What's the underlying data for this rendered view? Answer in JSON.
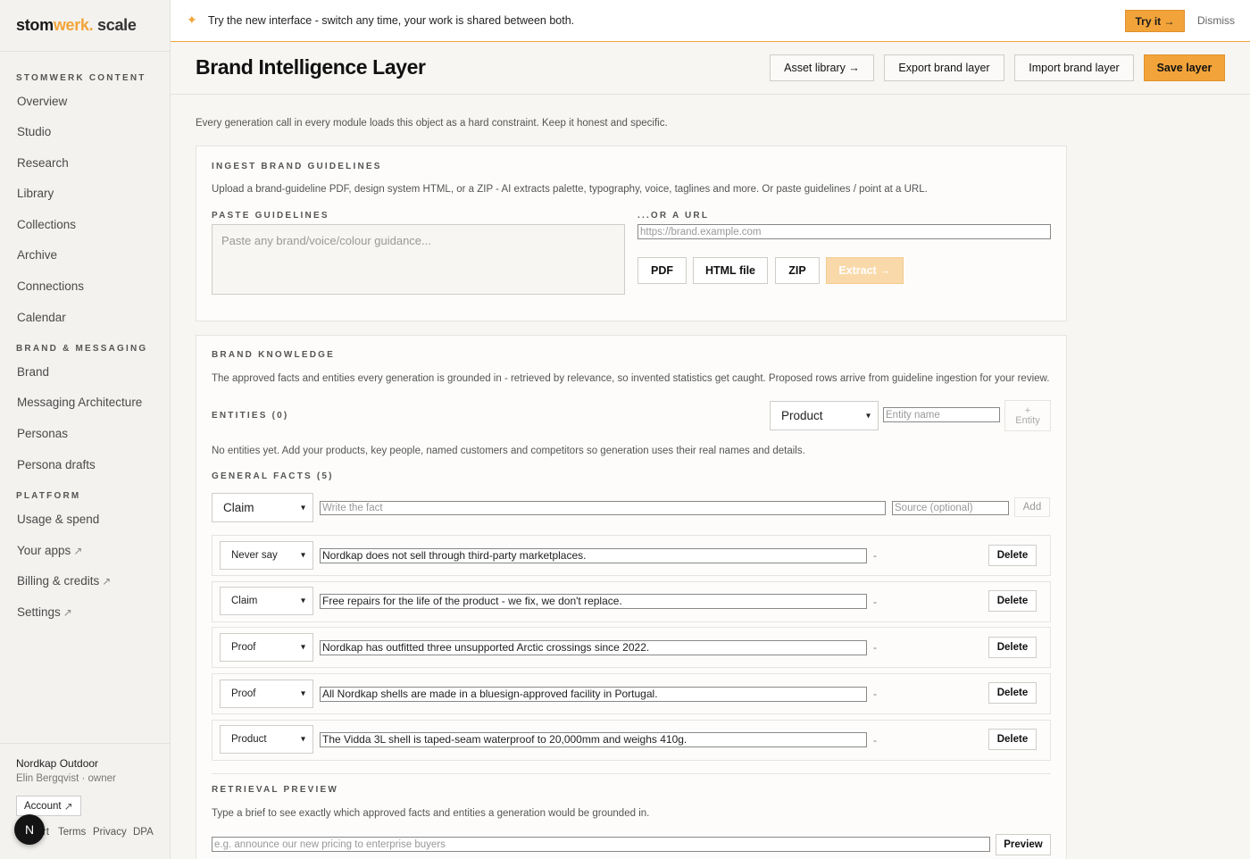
{
  "app": {
    "logo_part1": "stom",
    "logo_part2": "werk.",
    "logo_part3": " scale"
  },
  "sidebar": {
    "sections": [
      {
        "label": "STOMWERK CONTENT"
      },
      {
        "label": "BRAND & MESSAGING"
      },
      {
        "label": "PLATFORM"
      }
    ],
    "items": [
      {
        "label": "Overview"
      },
      {
        "label": "Studio"
      },
      {
        "label": "Research"
      },
      {
        "label": "Library"
      },
      {
        "label": "Collections"
      },
      {
        "label": "Archive"
      },
      {
        "label": "Connections"
      },
      {
        "label": "Calendar"
      },
      {
        "label": "Brand"
      },
      {
        "label": "Messaging Architecture"
      },
      {
        "label": "Personas"
      },
      {
        "label": "Persona drafts"
      },
      {
        "label": "Usage & spend"
      },
      {
        "label": "Your apps"
      },
      {
        "label": "Billing & credits"
      },
      {
        "label": "Settings"
      }
    ],
    "ext_arrow": "↗",
    "org": "Nordkap Outdoor",
    "user": "Elin Bergqvist · owner",
    "account_label": "Account",
    "footer_links": [
      "rt",
      "Terms",
      "Privacy",
      "DPA"
    ],
    "avatar_letter": "N"
  },
  "banner": {
    "text": "Try the new interface - switch any time, your work is shared between both.",
    "try_label": "Try it →",
    "dismiss_label": "Dismiss"
  },
  "header": {
    "title": "Brand Intelligence Layer",
    "asset_library": "Asset library →",
    "export": "Export brand layer",
    "import": "Import brand layer",
    "save": "Save layer"
  },
  "intro": "Every generation call in every module loads this object as a hard constraint. Keep it honest and specific.",
  "ingest": {
    "label": "INGEST BRAND GUIDELINES",
    "desc": "Upload a brand-guideline PDF, design system HTML, or a ZIP - AI extracts palette, typography, voice, taglines and more. Or paste guidelines / point at a URL.",
    "paste_label": "PASTE GUIDELINES",
    "paste_placeholder": "Paste any brand/voice/colour guidance...",
    "url_label": "...OR A URL",
    "url_placeholder": "https://brand.example.com",
    "btn_pdf": "PDF",
    "btn_html": "HTML file",
    "btn_zip": "ZIP",
    "btn_extract": "Extract →"
  },
  "knowledge": {
    "label": "BRAND KNOWLEDGE",
    "desc": "The approved facts and entities every generation is grounded in - retrieved by relevance, so invented statistics get caught. Proposed rows arrive from guideline ingestion for your review.",
    "entities_label": "ENTITIES (0)",
    "entity_type": "Product",
    "entity_name_placeholder": "Entity name",
    "entity_add_plus": "+",
    "entity_add_label": "Entity",
    "no_entities": "No entities yet. Add your products, key people, named customers and competitors so generation uses their real names and details.",
    "facts_label": "GENERAL FACTS (5)",
    "new_fact_type": "Claim",
    "fact_placeholder": "Write the fact",
    "source_placeholder": "Source (optional)",
    "add_label": "Add",
    "delete_label": "Delete",
    "dash": "-",
    "facts": [
      {
        "type": "Never say",
        "text": "Nordkap does not sell through third-party marketplaces."
      },
      {
        "type": "Claim",
        "text": "Free repairs for the life of the product - we fix, we don't replace."
      },
      {
        "type": "Proof",
        "text": "Nordkap has outfitted three unsupported Arctic crossings since 2022."
      },
      {
        "type": "Proof",
        "text": "All Nordkap shells are made in a bluesign-approved facility in Portugal."
      },
      {
        "type": "Product",
        "text": "The Vidda 3L shell is taped-seam waterproof to 20,000mm and weighs 410g."
      }
    ]
  },
  "retrieval": {
    "label": "RETRIEVAL PREVIEW",
    "desc": "Type a brief to see exactly which approved facts and entities a generation would be grounded in.",
    "placeholder": "e.g. announce our new pricing to enterprise buyers",
    "preview_label": "Preview"
  },
  "colors": {
    "accent": "#f2a43a",
    "accent_disabled": "#f9d9a9"
  }
}
